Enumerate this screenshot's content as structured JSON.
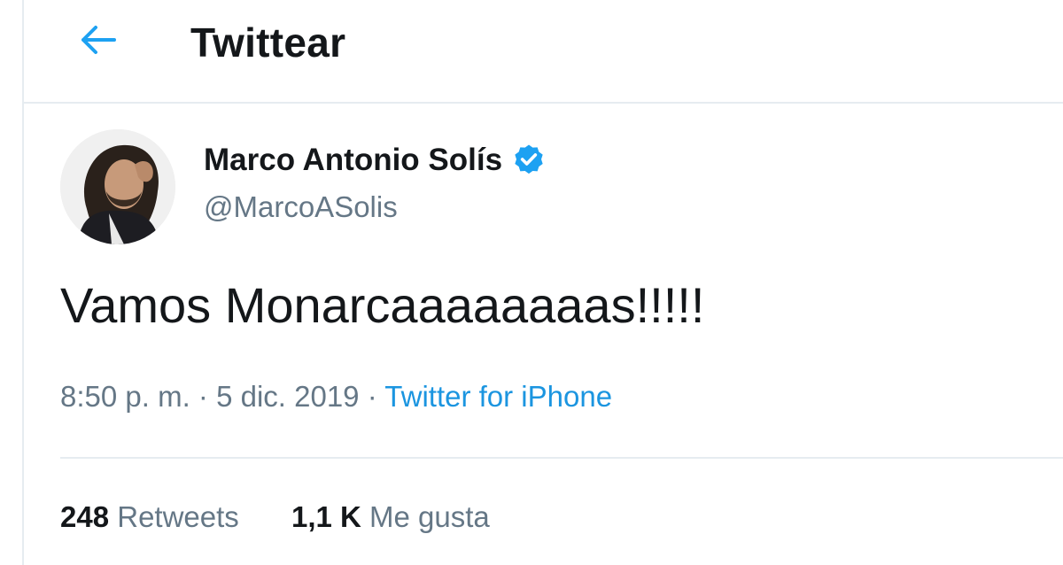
{
  "header": {
    "back_icon": "arrow-left-icon",
    "title": "Twittear"
  },
  "tweet": {
    "author": {
      "display_name": "Marco Antonio Solís",
      "verified_icon": "verified-badge-icon",
      "handle": "@MarcoASolis"
    },
    "text": "Vamos Monarcaaaaaaaas!!!!!",
    "time": "8:50 p. m.",
    "separator1": " · ",
    "date": "5 dic. 2019",
    "separator2": " · ",
    "source": "Twitter for iPhone"
  },
  "stats": {
    "retweets_count": "248",
    "retweets_label": "Retweets",
    "likes_count": "1,1 K",
    "likes_label": "Me gusta"
  },
  "colors": {
    "accent": "#1DA1F2",
    "link": "#1B95E0",
    "secondary_text": "#657786",
    "primary_text": "#14171A",
    "border": "#E6ECF0"
  }
}
